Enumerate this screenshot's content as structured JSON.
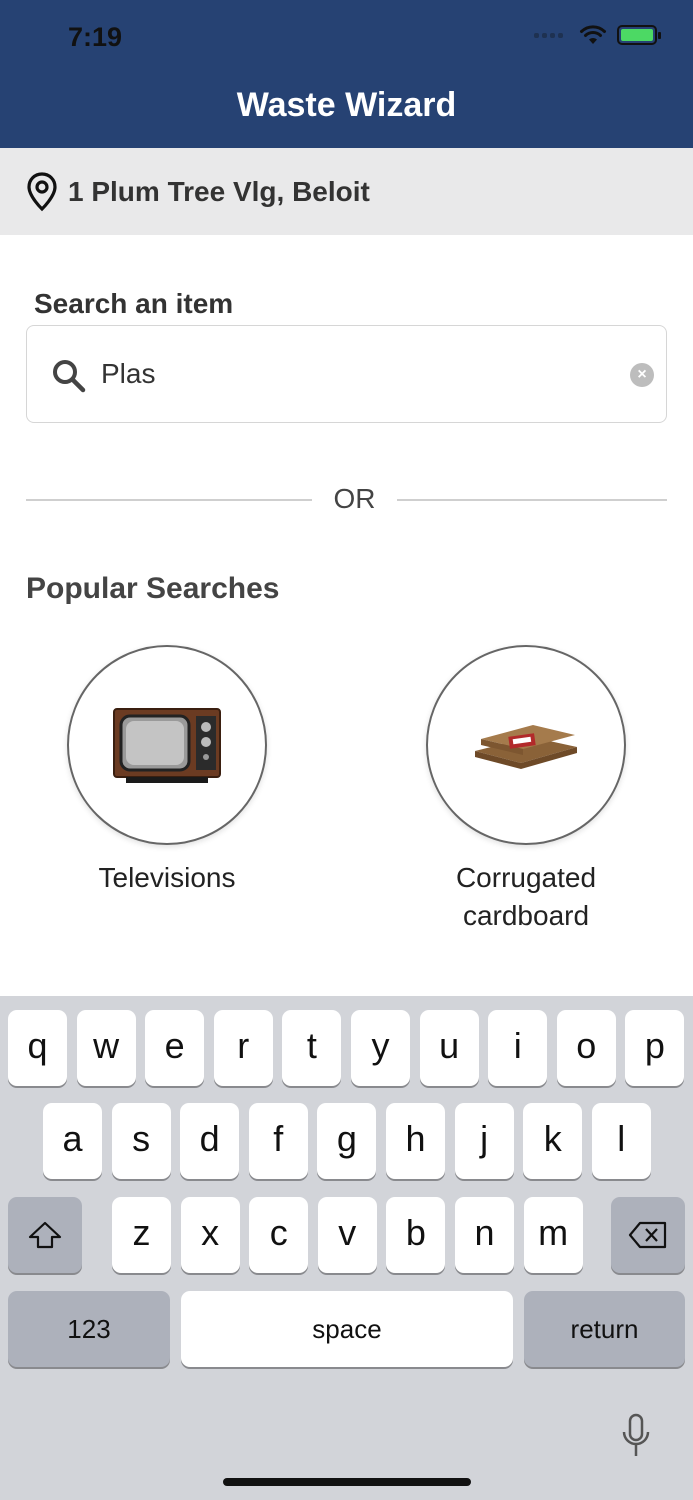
{
  "status": {
    "time": "7:19"
  },
  "header": {
    "title": "Waste Wizard"
  },
  "location": {
    "address": "1 Plum Tree Vlg, Beloit"
  },
  "search": {
    "label": "Search an item",
    "value": "Plas"
  },
  "divider": {
    "text": "OR"
  },
  "popular": {
    "title": "Popular Searches",
    "items": [
      {
        "label": "Televisions"
      },
      {
        "label": "Corrugated cardboard"
      }
    ]
  },
  "keyboard": {
    "row1": [
      "q",
      "w",
      "e",
      "r",
      "t",
      "y",
      "u",
      "i",
      "o",
      "p"
    ],
    "row2": [
      "a",
      "s",
      "d",
      "f",
      "g",
      "h",
      "j",
      "k",
      "l"
    ],
    "row3": [
      "z",
      "x",
      "c",
      "v",
      "b",
      "n",
      "m"
    ],
    "numbers_label": "123",
    "space_label": "space",
    "return_label": "return"
  },
  "icons": {
    "location": "location-pin-icon",
    "search": "search-icon",
    "clear": "clear-icon",
    "shift": "shift-icon",
    "backspace": "backspace-icon",
    "mic": "microphone-icon"
  },
  "colors": {
    "header": "#264273",
    "location_bar": "#e9e9ea",
    "keyboard": "#d2d4d9"
  }
}
